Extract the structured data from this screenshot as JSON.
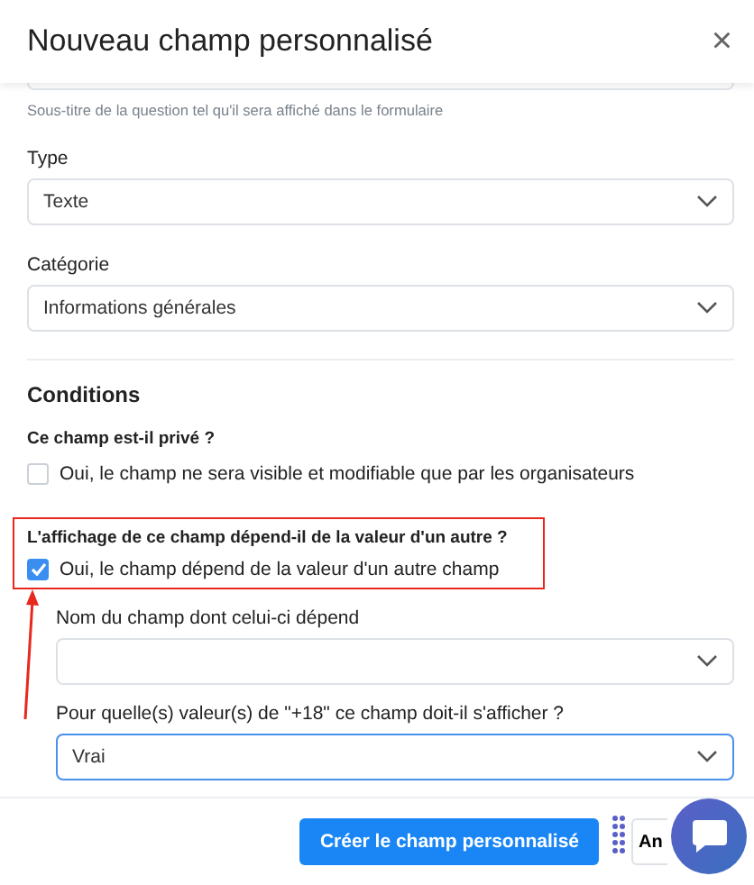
{
  "dialog": {
    "title": "Nouveau champ personnalisé",
    "close": "×"
  },
  "subtitle_help": "Sous-titre de la question tel qu'il sera affiché dans le formulaire",
  "selects": [
    {
      "label": "Type",
      "value": "Texte"
    },
    {
      "label": "Catégorie",
      "value": "Informations générales"
    }
  ],
  "conditions": {
    "title": "Conditions",
    "questions": [
      {
        "label": "Ce champ est-il privé ?",
        "option": "Oui, le champ ne sera visible et modifiable que par les organisateurs",
        "checked": false,
        "highlighted": false
      },
      {
        "label": "L'affichage de ce champ dépend-il de la valeur d'un autre ?",
        "option": "Oui, le champ dépend de la valeur d'un autre champ",
        "checked": true,
        "highlighted": true
      }
    ],
    "dependent": [
      {
        "label": "Nom du champ dont celui-ci dépend",
        "focused": false
      },
      {
        "label": "Pour quelle(s) valeur(s) de \"+18\" ce champ doit-il s'afficher ?",
        "value": "Vrai",
        "focused": true
      }
    ]
  },
  "footer": {
    "primary": "Créer le champ personnalisé",
    "secondary": "An"
  }
}
